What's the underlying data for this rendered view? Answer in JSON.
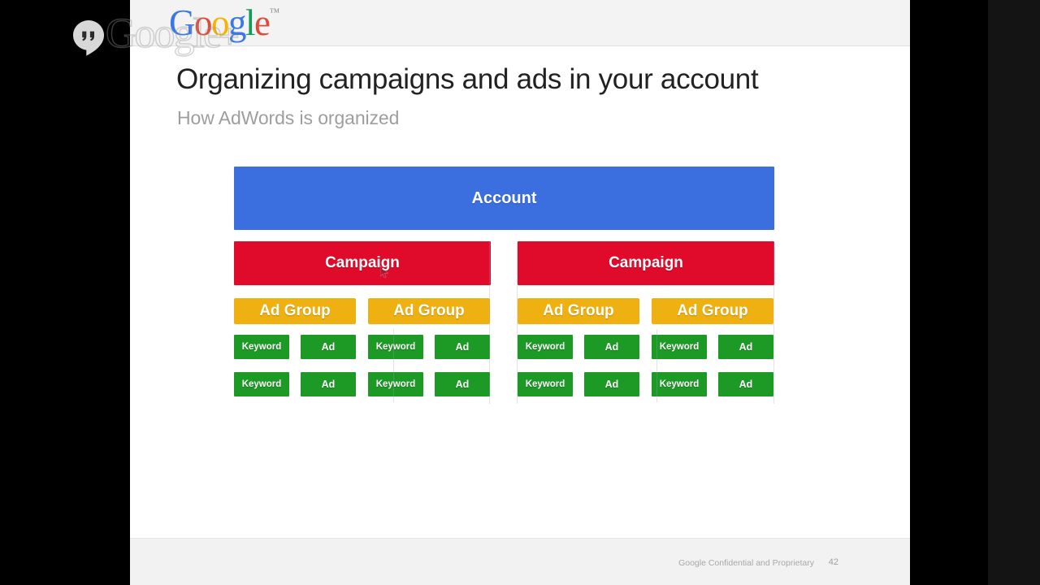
{
  "window": {
    "background_color": "#000000",
    "letterbox_color": "#141414"
  },
  "overlay": {
    "hangouts_icon_name": "hangouts-icon",
    "watermark_text": "Google",
    "watermark_plus": "+"
  },
  "slide": {
    "header": {
      "logo": {
        "g1": "G",
        "o1": "o",
        "o2": "o",
        "g2": "g",
        "l": "l",
        "e": "e",
        "tm": "™"
      }
    },
    "title": "Organizing campaigns and ads in your account",
    "subtitle": "How AdWords is organized",
    "footer": {
      "confidential": "Google Confidential and Proprietary",
      "page_number": "42"
    },
    "colors": {
      "account": "#3b6fe0",
      "campaign": "#e00b2b",
      "ad_group": "#eeb111",
      "leaf": "#1d9a26",
      "title": "#222222",
      "subtitle": "#9e9e9e",
      "header_band": "#f3f3f3",
      "footer_band": "#f2f2f2"
    }
  },
  "diagram": {
    "account": {
      "label": "Account"
    },
    "campaigns": [
      {
        "label": "Campaign",
        "ad_groups": [
          {
            "label": "Ad Group",
            "leaves": [
              {
                "label": "Keyword",
                "type": "keyword"
              },
              {
                "label": "Ad",
                "type": "ad"
              },
              {
                "label": "Keyword",
                "type": "keyword"
              },
              {
                "label": "Ad",
                "type": "ad"
              }
            ]
          },
          {
            "label": "Ad Group",
            "leaves": [
              {
                "label": "Keyword",
                "type": "keyword"
              },
              {
                "label": "Ad",
                "type": "ad"
              },
              {
                "label": "Keyword",
                "type": "keyword"
              },
              {
                "label": "Ad",
                "type": "ad"
              }
            ]
          }
        ]
      },
      {
        "label": "Campaign",
        "ad_groups": [
          {
            "label": "Ad Group",
            "leaves": [
              {
                "label": "Keyword",
                "type": "keyword"
              },
              {
                "label": "Ad",
                "type": "ad"
              },
              {
                "label": "Keyword",
                "type": "keyword"
              },
              {
                "label": "Ad",
                "type": "ad"
              }
            ]
          },
          {
            "label": "Ad Group",
            "leaves": [
              {
                "label": "Keyword",
                "type": "keyword"
              },
              {
                "label": "Ad",
                "type": "ad"
              },
              {
                "label": "Keyword",
                "type": "keyword"
              },
              {
                "label": "Ad",
                "type": "ad"
              }
            ]
          }
        ]
      }
    ]
  }
}
